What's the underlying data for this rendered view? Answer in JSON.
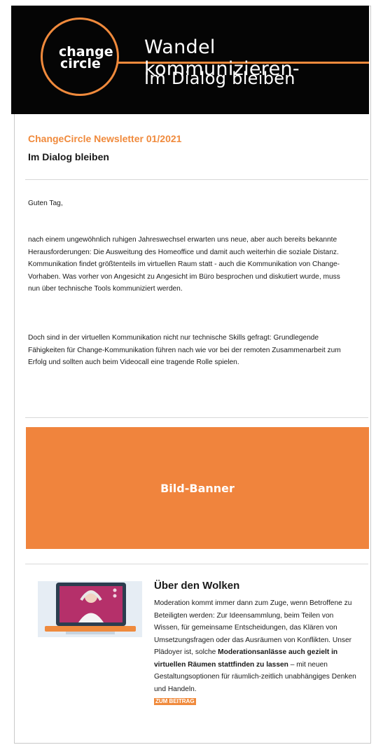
{
  "header": {
    "logo_line1": "change",
    "logo_line2": "circle",
    "tagline_1": "Wandel kommunizieren-",
    "tagline_2": "Im Dialog bleiben",
    "colors": {
      "background": "#050505",
      "accent": "#f08a3c"
    }
  },
  "newsletter": {
    "title": "ChangeCircle Newsletter 01/2021",
    "subtitle": "Im Dialog bleiben"
  },
  "body": {
    "greeting": "Guten Tag,",
    "paragraph1": "nach einem ungewöhnlich ruhigen Jahreswechsel erwarten uns neue, aber auch bereits bekannte Herausforderungen: Die Ausweitung des Homeoffice und damit auch weiterhin die soziale Distanz. Kommunikation findet größtenteils im virtuellen Raum statt - auch die Kommunikation von Change-Vorhaben. Was vorher von Angesicht zu Angesicht im Büro besprochen und diskutiert wurde, muss nun über technische Tools kommuniziert werden.",
    "paragraph2": "Doch sind in der virtuellen Kommunikation nicht nur technische Skills gefragt: Grundlegende Fähigkeiten für Change-Kommunikation führen nach wie vor bei der remoten Zusammenarbeit zum Erfolg und sollten auch beim Videocall eine tragende Rolle spielen."
  },
  "banner": {
    "label": "Bild-Banner",
    "color": "#f0843d"
  },
  "article": {
    "title": "Über den Wolken",
    "text_intro": "Moderation kommt immer dann zum Zuge, wenn Betroffene zu Beteiligten werden: Zur Ideensammlung, beim Teilen von Wissen, für gemeinsame Entscheidungen, das Klären von Umsetzungsfragen oder das Ausräumen von Konflikten. Unser Plädoyer ist, solche ",
    "text_bold": "Moderationsanlässe auch gezielt in virtuellen Räumen stattfinden zu lassen",
    "text_outro": " – mit neuen Gestaltungsoptionen für räumlich-zeitlich unabhängiges Denken und Handeln.",
    "cta_label": "ZUM BEITRAG",
    "image_icon": "video-call-illustration-icon"
  }
}
